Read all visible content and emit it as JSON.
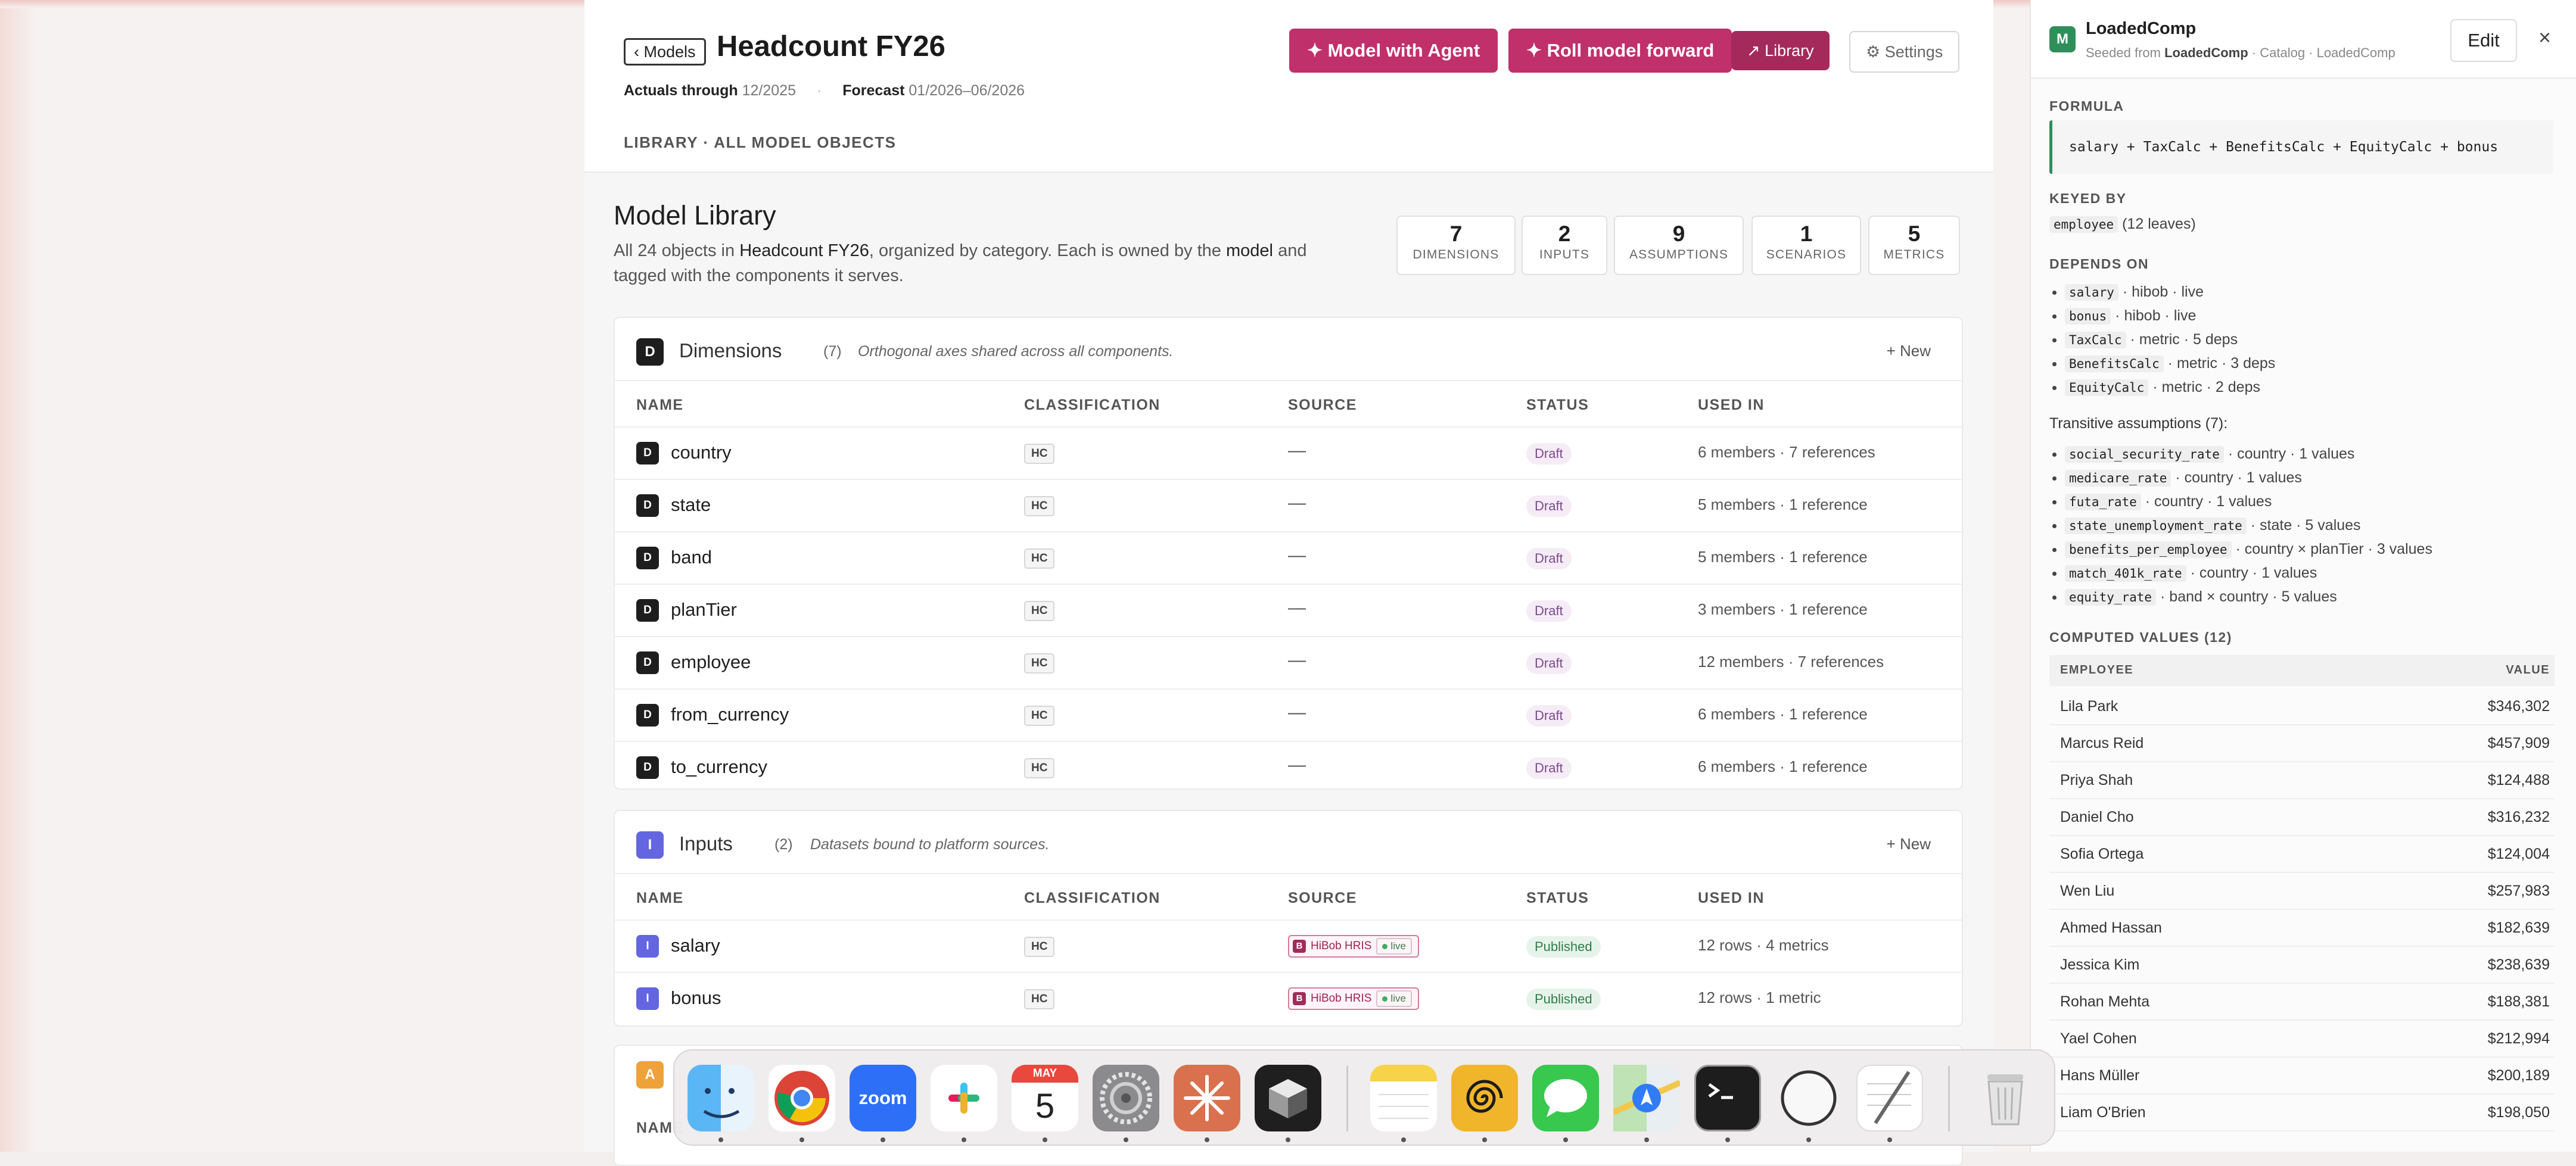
{
  "header": {
    "back_label": "‹ Models",
    "title": "Headcount FY26",
    "actuals_label": "Actuals through",
    "actuals_value": "12/2025",
    "forecast_label": "Forecast",
    "forecast_value": "01/2026–06/2026",
    "breadcrumb": "LIBRARY · ALL MODEL OBJECTS",
    "model_with_agent": "✦ Model with Agent",
    "roll_forward": "✦ Roll model forward",
    "library": "↗ Library",
    "settings": "⚙ Settings"
  },
  "library": {
    "title": "Model Library",
    "desc_prefix": "All 24 objects in",
    "desc_model": "Headcount FY26",
    "desc_mid": ", organized by category. Each is owned by the",
    "desc_model_word": "model",
    "desc_suffix": "and tagged with the components it serves.",
    "stats": [
      {
        "count": "7",
        "label": "DIMENSIONS"
      },
      {
        "count": "2",
        "label": "INPUTS"
      },
      {
        "count": "9",
        "label": "ASSUMPTIONS"
      },
      {
        "count": "1",
        "label": "SCENARIOS"
      },
      {
        "count": "5",
        "label": "METRICS"
      }
    ]
  },
  "columns": {
    "name": "NAME",
    "classification": "CLASSIFICATION",
    "source": "SOURCE",
    "status": "STATUS",
    "used_in": "USED IN"
  },
  "dimensions": {
    "badge": "D",
    "title": "Dimensions",
    "count": "(7)",
    "desc": "Orthogonal axes shared across all components.",
    "new": "+ New",
    "rows": [
      {
        "name": "country",
        "cls": "HC",
        "source": "—",
        "status": "Draft",
        "used": "6 members · 7 references"
      },
      {
        "name": "state",
        "cls": "HC",
        "source": "—",
        "status": "Draft",
        "used": "5 members · 1 reference"
      },
      {
        "name": "band",
        "cls": "HC",
        "source": "—",
        "status": "Draft",
        "used": "5 members · 1 reference"
      },
      {
        "name": "planTier",
        "cls": "HC",
        "source": "—",
        "status": "Draft",
        "used": "3 members · 1 reference"
      },
      {
        "name": "employee",
        "cls": "HC",
        "source": "—",
        "status": "Draft",
        "used": "12 members · 7 references"
      },
      {
        "name": "from_currency",
        "cls": "HC",
        "source": "—",
        "status": "Draft",
        "used": "6 members · 1 reference"
      },
      {
        "name": "to_currency",
        "cls": "HC",
        "source": "—",
        "status": "Draft",
        "used": "6 members · 1 reference"
      }
    ]
  },
  "inputs": {
    "badge": "I",
    "title": "Inputs",
    "count": "(2)",
    "desc": "Datasets bound to platform sources.",
    "new": "+ New",
    "source_badge": "B",
    "source_name": "HiBob HRIS",
    "source_live": "live",
    "rows": [
      {
        "name": "salary",
        "cls": "HC",
        "status": "Published",
        "used": "12 rows · 4 metrics"
      },
      {
        "name": "bonus",
        "cls": "HC",
        "status": "Published",
        "used": "12 rows · 1 metric"
      }
    ]
  },
  "assumptions_partial": {
    "badge": "A",
    "col_name": "NAME"
  },
  "side": {
    "badge": "M",
    "title": "LoadedComp",
    "sub_prefix": "Seeded from",
    "sub_bold": "LoadedComp",
    "sub_suffix": "· Catalog · LoadedComp",
    "edit": "Edit",
    "close": "×",
    "formula_label": "FORMULA",
    "formula": "salary + TaxCalc + BenefitsCalc + EquityCalc + bonus",
    "keyed_label": "KEYED BY",
    "keyed_code": "employee",
    "keyed_suffix": "(12 leaves)",
    "depends_label": "DEPENDS ON",
    "depends": [
      {
        "code": "salary",
        "text": "· hibob · live"
      },
      {
        "code": "bonus",
        "text": "· hibob · live"
      },
      {
        "code": "TaxCalc",
        "text": "· metric · 5 deps"
      },
      {
        "code": "BenefitsCalc",
        "text": "· metric · 3 deps"
      },
      {
        "code": "EquityCalc",
        "text": "· metric · 2 deps"
      }
    ],
    "transitive_label": "Transitive assumptions (7):",
    "transitive": [
      {
        "code": "social_security_rate",
        "text": "· country · 1 values"
      },
      {
        "code": "medicare_rate",
        "text": "· country · 1 values"
      },
      {
        "code": "futa_rate",
        "text": "· country · 1 values"
      },
      {
        "code": "state_unemployment_rate",
        "text": "· state · 5 values"
      },
      {
        "code": "benefits_per_employee",
        "text": "· country × planTier · 3 values"
      },
      {
        "code": "match_401k_rate",
        "text": "· country · 1 values"
      },
      {
        "code": "equity_rate",
        "text": "· band × country · 5 values"
      }
    ],
    "computed_label": "COMPUTED VALUES (12)",
    "col_employee": "EMPLOYEE",
    "col_value": "VALUE",
    "computed": [
      {
        "name": "Lila Park",
        "value": "$346,302"
      },
      {
        "name": "Marcus Reid",
        "value": "$457,909"
      },
      {
        "name": "Priya Shah",
        "value": "$124,488"
      },
      {
        "name": "Daniel Cho",
        "value": "$316,232"
      },
      {
        "name": "Sofia Ortega",
        "value": "$124,004"
      },
      {
        "name": "Wen Liu",
        "value": "$257,983"
      },
      {
        "name": "Ahmed Hassan",
        "value": "$182,639"
      },
      {
        "name": "Jessica Kim",
        "value": "$238,639"
      },
      {
        "name": "Rohan Mehta",
        "value": "$188,381"
      },
      {
        "name": "Yael Cohen",
        "value": "$212,994"
      },
      {
        "name": "Hans Müller",
        "value": "$200,189"
      },
      {
        "name": "Liam O'Brien",
        "value": "$198,050"
      }
    ]
  },
  "dock": {
    "calendar_month": "MAY",
    "calendar_day": "5",
    "zoom_label": "zoom",
    "apps": [
      "finder-icon",
      "chrome-icon",
      "zoom-icon",
      "slack-icon",
      "calendar-icon",
      "system-settings-icon",
      "claude-icon",
      "cube-app-icon",
      "notes-icon",
      "spiral-app-icon",
      "messages-icon",
      "maps-icon",
      "terminal-icon",
      "circle-app-icon",
      "textedit-icon",
      "trash-icon"
    ]
  },
  "colors": {
    "accent": "#c0306b",
    "accent_dark": "#a52a5c",
    "dim_badge": "#1e1e1e",
    "input_badge": "#6366e0",
    "assumption_badge": "#f0a23a",
    "metric_badge": "#2f8f5b"
  }
}
